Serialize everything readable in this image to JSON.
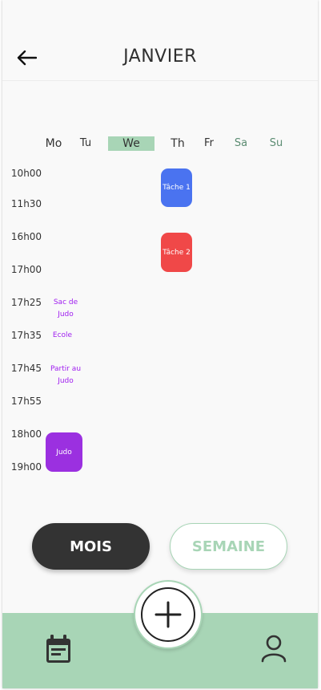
{
  "header": {
    "title": "JANVIER",
    "back_icon": "arrow-left-icon"
  },
  "days": [
    {
      "label": "Mo",
      "weekend": false,
      "selected": false
    },
    {
      "label": "Tu",
      "weekend": false,
      "selected": false
    },
    {
      "label": "We",
      "weekend": false,
      "selected": true
    },
    {
      "label": "Th",
      "weekend": false,
      "selected": false
    },
    {
      "label": "Fr",
      "weekend": false,
      "selected": false
    },
    {
      "label": "Sa",
      "weekend": true,
      "selected": false
    },
    {
      "label": "Su",
      "weekend": true,
      "selected": false
    }
  ],
  "times": [
    "10h00",
    "11h30",
    "16h00",
    "17h00",
    "17h25",
    "17h35",
    "17h45",
    "17h55",
    "18h00",
    "19h00"
  ],
  "events": [
    {
      "label": "Tâche 1",
      "color": "#4a73f0"
    },
    {
      "label": "Tâche 2",
      "color": "#f04848"
    },
    {
      "label": "Judo",
      "color": "#9b30e0"
    }
  ],
  "notes": [
    {
      "line1": "Sac de",
      "line2": "Judo"
    },
    {
      "line1": "Ecole",
      "line2": ""
    },
    {
      "line1": "Partir au",
      "line2": "Judo"
    }
  ],
  "view_toggle": {
    "month_label": "MOIS",
    "week_label": "SEMAINE"
  },
  "colors": {
    "accent": "#a8d5b6",
    "dark": "#333333",
    "note": "#a020f0"
  },
  "tabbar": {
    "calendar_icon": "calendar-icon",
    "add_icon": "plus-icon",
    "profile_icon": "user-icon"
  }
}
